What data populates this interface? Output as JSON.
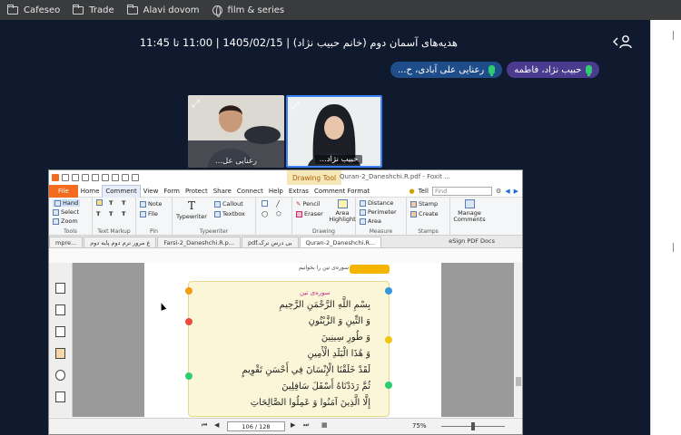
{
  "bookmarks": [
    {
      "label": "Cafeseo",
      "icon": "folder-icon"
    },
    {
      "label": "Trade",
      "icon": "folder-icon"
    },
    {
      "label": "Alavi dovom",
      "icon": "folder-icon"
    },
    {
      "label": "film & series",
      "icon": "globe-icon"
    }
  ],
  "meeting": {
    "title": "هدیه‌های آسمان دوم (خانم حبیب نژاد) | 1405/02/15 | 11:00 تا 11:45",
    "speakers": [
      {
        "name": "حبیب نژاد، فاطمه"
      },
      {
        "name": "رعنایی علی آبادی، ح..."
      }
    ],
    "videos": [
      {
        "name": "رعنایی عل..."
      },
      {
        "name": "حبیب نژاد..."
      }
    ]
  },
  "app": {
    "drawing_tool_label": "Drawing Tool",
    "filename": "Quran-2_Daneshchi.R.pdf - Foxit ...",
    "menu": [
      "File",
      "Home",
      "Comment",
      "View",
      "Form",
      "Protect",
      "Share",
      "Connect",
      "Help",
      "Extras",
      "Comment Format"
    ],
    "tell_me": "Tell",
    "find_placeholder": "Find",
    "ribbon": {
      "tools": {
        "items": [
          "Hand",
          "Select",
          "Zoom"
        ],
        "label": "Tools"
      },
      "text_markup": {
        "items": [
          "T",
          "T",
          "T",
          "T",
          "T",
          "T"
        ],
        "label": "Text Markup"
      },
      "pin": {
        "items": [
          "Note",
          "File"
        ],
        "label": "Pin"
      },
      "typewriter": {
        "items": [
          "Typewriter",
          "Callout",
          "Textbox"
        ],
        "label": "Typewriter"
      },
      "drawing": {
        "items": [
          "Pencil",
          "Eraser",
          "Area Highlight"
        ],
        "label": "Drawing"
      },
      "measure": {
        "items": [
          "Distance",
          "Perimeter",
          "Area"
        ],
        "label": "Measure"
      },
      "stamps": {
        "items": [
          "Stamp",
          "Create"
        ],
        "label": "Stamps"
      },
      "manage": {
        "label": "Manage Comments"
      }
    },
    "tabs": [
      {
        "label": "mpre...",
        "active": false
      },
      {
        "label": "ع مرور ترم دوم پایه دوم",
        "active": false
      },
      {
        "label": "Farsi-2_Daneshchi.R.p...",
        "active": false
      },
      {
        "label": "pdf.بی درس ترک",
        "active": false
      },
      {
        "label": "Quran-2_Daneshchi.R...",
        "active": true
      }
    ],
    "esign_label": "eSign PDF Docs",
    "status": {
      "page_display": "106 / 128",
      "zoom": "75%"
    },
    "page": {
      "header_hint": "... سوره‌ی تین را بخوانیم",
      "surah_title": "سوره‌ی تین",
      "lines": [
        "بِسْمِ اللَّهِ الرَّحْمَنِ الرَّحِيمِ",
        "وَ التِّينِ وَ الزَّيْتُونِ",
        "وَ طُورِ سِينِينَ",
        "وَ هَٰذَا الْبَلَدِ الْأَمِينِ",
        "لَقَدْ خَلَقْنَا الْإِنْسَانَ فِي أَحْسَنِ تَقْوِيمٍ",
        "ثُمَّ رَدَدْنَاهُ أَسْفَلَ سَافِلِينَ",
        "إِلَّا الَّذِينَ آمَنُوا وَ عَمِلُوا الصَّالِحَاتِ"
      ]
    }
  }
}
